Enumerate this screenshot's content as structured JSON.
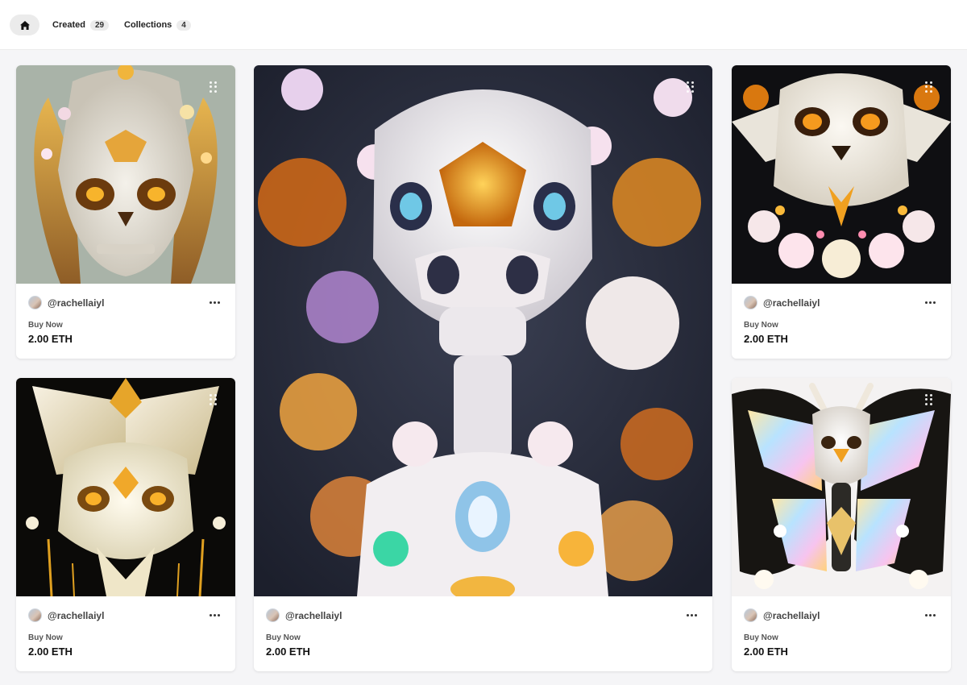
{
  "nav": {
    "home_icon": "home-icon",
    "tabs": [
      {
        "label": "Created",
        "count": "29"
      },
      {
        "label": "Collections",
        "count": "4"
      }
    ]
  },
  "cards": [
    {
      "creator": "@rachellaiyl",
      "label": "Buy Now",
      "price": "2.00 ETH",
      "art": "white marble skull with golden butterfly wings on sage background"
    },
    {
      "creator": "@rachellaiyl",
      "label": "Buy Now",
      "price": "2.00 ETH",
      "art": "glossy white alien skull bust with gold and opal gems and flowers on dark background"
    },
    {
      "creator": "@rachellaiyl",
      "label": "Buy Now",
      "price": "2.00 ETH",
      "art": "symmetrical white skull with amber jewels and blossoms on black background"
    },
    {
      "creator": "@rachellaiyl",
      "label": "Buy Now",
      "price": "2.00 ETH",
      "art": "cream and gold winged skull with dripping gold on black background"
    },
    {
      "creator": "@rachellaiyl",
      "label": "Buy Now",
      "price": "2.00 ETH",
      "art": "horned skull with iridescent stained-glass butterfly wings on white background"
    }
  ],
  "colors": {
    "accent": "#111111",
    "page_bg": "#f5f5f7"
  }
}
